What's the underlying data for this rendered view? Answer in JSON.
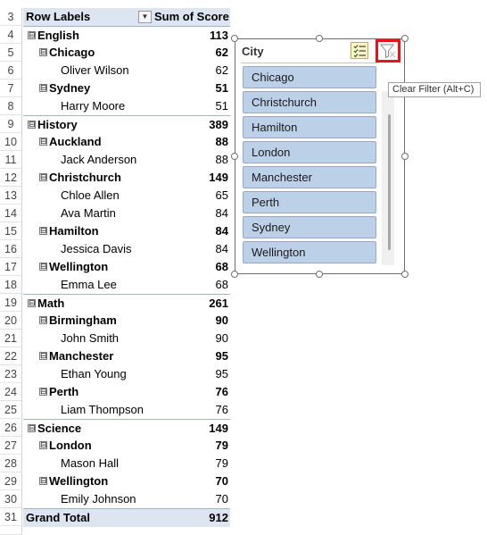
{
  "pivot": {
    "header": {
      "row_labels": "Row Labels",
      "value_header": "Sum of Score"
    },
    "rows": [
      {
        "num": "3"
      },
      {
        "num": "4",
        "label": "English",
        "value": "113",
        "level": 0
      },
      {
        "num": "5",
        "label": "Chicago",
        "value": "62",
        "level": 1
      },
      {
        "num": "6",
        "label": "Oliver Wilson",
        "value": "62",
        "level": 2
      },
      {
        "num": "7",
        "label": "Sydney",
        "value": "51",
        "level": 1
      },
      {
        "num": "8",
        "label": "Harry Moore",
        "value": "51",
        "level": 2
      },
      {
        "num": "9",
        "label": "History",
        "value": "389",
        "level": 0
      },
      {
        "num": "10",
        "label": "Auckland",
        "value": "88",
        "level": 1
      },
      {
        "num": "11",
        "label": "Jack Anderson",
        "value": "88",
        "level": 2
      },
      {
        "num": "12",
        "label": "Christchurch",
        "value": "149",
        "level": 1
      },
      {
        "num": "13",
        "label": "Chloe Allen",
        "value": "65",
        "level": 2
      },
      {
        "num": "14",
        "label": "Ava Martin",
        "value": "84",
        "level": 2
      },
      {
        "num": "15",
        "label": "Hamilton",
        "value": "84",
        "level": 1
      },
      {
        "num": "16",
        "label": "Jessica Davis",
        "value": "84",
        "level": 2
      },
      {
        "num": "17",
        "label": "Wellington",
        "value": "68",
        "level": 1
      },
      {
        "num": "18",
        "label": "Emma Lee",
        "value": "68",
        "level": 2
      },
      {
        "num": "19",
        "label": "Math",
        "value": "261",
        "level": 0
      },
      {
        "num": "20",
        "label": "Birmingham",
        "value": "90",
        "level": 1
      },
      {
        "num": "21",
        "label": "John Smith",
        "value": "90",
        "level": 2
      },
      {
        "num": "22",
        "label": "Manchester",
        "value": "95",
        "level": 1
      },
      {
        "num": "23",
        "label": "Ethan Young",
        "value": "95",
        "level": 2
      },
      {
        "num": "24",
        "label": "Perth",
        "value": "76",
        "level": 1
      },
      {
        "num": "25",
        "label": "Liam Thompson",
        "value": "76",
        "level": 2
      },
      {
        "num": "26",
        "label": "Science",
        "value": "149",
        "level": 0
      },
      {
        "num": "27",
        "label": "London",
        "value": "79",
        "level": 1
      },
      {
        "num": "28",
        "label": "Mason Hall",
        "value": "79",
        "level": 2
      },
      {
        "num": "29",
        "label": "Wellington",
        "value": "70",
        "level": 1
      },
      {
        "num": "30",
        "label": "Emily Johnson",
        "value": "70",
        "level": 2
      },
      {
        "num": "31",
        "label": "Grand Total",
        "value": "912",
        "level": "total"
      }
    ],
    "collapse_symbol": "⊟"
  },
  "slicer": {
    "title": "City",
    "items": [
      "Chicago",
      "Christchurch",
      "Hamilton",
      "London",
      "Manchester",
      "Perth",
      "Sydney",
      "Wellington"
    ],
    "multiselect_icon": "multi-select-icon",
    "clear_icon": "clear-filter-icon"
  },
  "tooltip": {
    "text": "Clear Filter (Alt+C)"
  },
  "colors": {
    "header_fill": "#dde5f0",
    "slicer_item": "#bcd0e8",
    "highlight_red": "#e8141a"
  }
}
